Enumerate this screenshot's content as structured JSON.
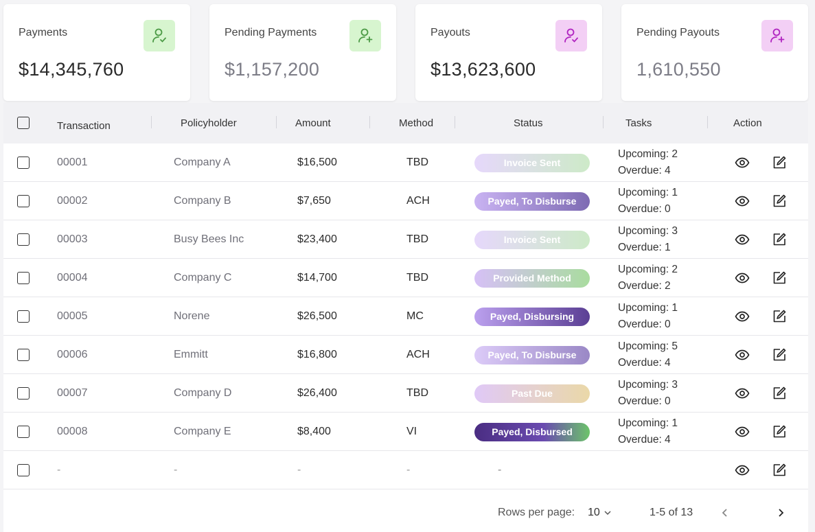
{
  "cards": [
    {
      "label": "Payments",
      "value": "$14,345,760",
      "icon": "user-check-icon",
      "badge_color": "#d7f5cf",
      "icon_color": "#4b9a45"
    },
    {
      "label": "Pending Payments",
      "value": "$1,157,200",
      "icon": "user-plus-icon",
      "badge_color": "#d7f5cf",
      "icon_color": "#4b9a45"
    },
    {
      "label": "Payouts",
      "value": "$13,623,600",
      "icon": "user-check-icon",
      "badge_color": "#f3cff5",
      "icon_color": "#b023c0"
    },
    {
      "label": "Pending Payouts",
      "value": "1,610,550",
      "icon": "user-plus-icon",
      "badge_color": "#f3cff5",
      "icon_color": "#b023c0"
    }
  ],
  "table": {
    "headers": {
      "transaction": "Transaction",
      "policyholder": "Policyholder",
      "amount": "Amount",
      "method": "Method",
      "status": "Status",
      "tasks": "Tasks",
      "action": "Action"
    },
    "rows": [
      {
        "transaction": "00001",
        "policyholder": "Company A",
        "amount": "$16,500",
        "method": "TBD",
        "status": "Invoice Sent",
        "status_style": "invoice",
        "upcoming": "Upcoming: 2",
        "overdue": "Overdue: 4"
      },
      {
        "transaction": "00002",
        "policyholder": "Company B",
        "amount": "$7,650",
        "method": "ACH",
        "status": "Payed, To Disburse",
        "status_style": "to-disburse",
        "upcoming": "Upcoming: 1",
        "overdue": "Overdue: 0"
      },
      {
        "transaction": "00003",
        "policyholder": "Busy Bees Inc",
        "amount": "$23,400",
        "method": "TBD",
        "status": "Invoice Sent",
        "status_style": "invoice",
        "upcoming": "Upcoming: 3",
        "overdue": "Overdue: 1"
      },
      {
        "transaction": "00004",
        "policyholder": "Company C",
        "amount": "$14,700",
        "method": "TBD",
        "status": "Provided Method",
        "status_style": "provided",
        "upcoming": "Upcoming: 2",
        "overdue": "Overdue: 2"
      },
      {
        "transaction": "00005",
        "policyholder": "Norene",
        "amount": "$26,500",
        "method": "MC",
        "status": "Payed, Disbursing",
        "status_style": "disbursing",
        "upcoming": "Upcoming: 1",
        "overdue": "Overdue: 0"
      },
      {
        "transaction": "00006",
        "policyholder": "Emmitt",
        "amount": "$16,800",
        "method": "ACH",
        "status": "Payed, To Disburse",
        "status_style": "to-disburse-light",
        "upcoming": "Upcoming: 5",
        "overdue": "Overdue: 4"
      },
      {
        "transaction": "00007",
        "policyholder": "Company D",
        "amount": "$26,400",
        "method": "TBD",
        "status": "Past Due",
        "status_style": "past-due",
        "upcoming": "Upcoming: 3",
        "overdue": "Overdue: 0"
      },
      {
        "transaction": "00008",
        "policyholder": "Company E",
        "amount": "$8,400",
        "method": "VI",
        "status": "Payed, Disbursed",
        "status_style": "disbursed",
        "upcoming": "Upcoming: 1",
        "overdue": "Overdue: 4"
      },
      {
        "transaction": "-",
        "policyholder": "-",
        "amount": "-",
        "method": "-",
        "status": "-",
        "status_style": "none",
        "upcoming": "",
        "overdue": ""
      }
    ]
  },
  "pagination": {
    "rows_per_page_label": "Rows per page:",
    "rows_per_page_value": "10",
    "range": "1-5 of 13"
  },
  "status_styles": {
    "invoice": {
      "gradient": "linear-gradient(90deg,#e6d8fb,#cdeac8)",
      "text": "#ffffff"
    },
    "to-disburse": {
      "gradient": "linear-gradient(90deg,#c9b3f2,#7e6bb3)",
      "text": "#ffffff"
    },
    "to-disburse-light": {
      "gradient": "linear-gradient(90deg,#dccbf8,#9a88c6)",
      "text": "#ffffff"
    },
    "provided": {
      "gradient": "linear-gradient(90deg,#d6c0f6,#a9dc9f)",
      "text": "#ffffff"
    },
    "disbursing": {
      "gradient": "linear-gradient(90deg,#bba0ee,#5b3f94)",
      "text": "#ffffff"
    },
    "past-due": {
      "gradient": "linear-gradient(90deg,#e0c9f7,#ead8a8)",
      "text": "#ffffff"
    },
    "disbursed": {
      "gradient": "linear-gradient(90deg,#4a2d82,#6a4bb0 60%,#6cc46a)",
      "text": "#ffffff"
    }
  }
}
